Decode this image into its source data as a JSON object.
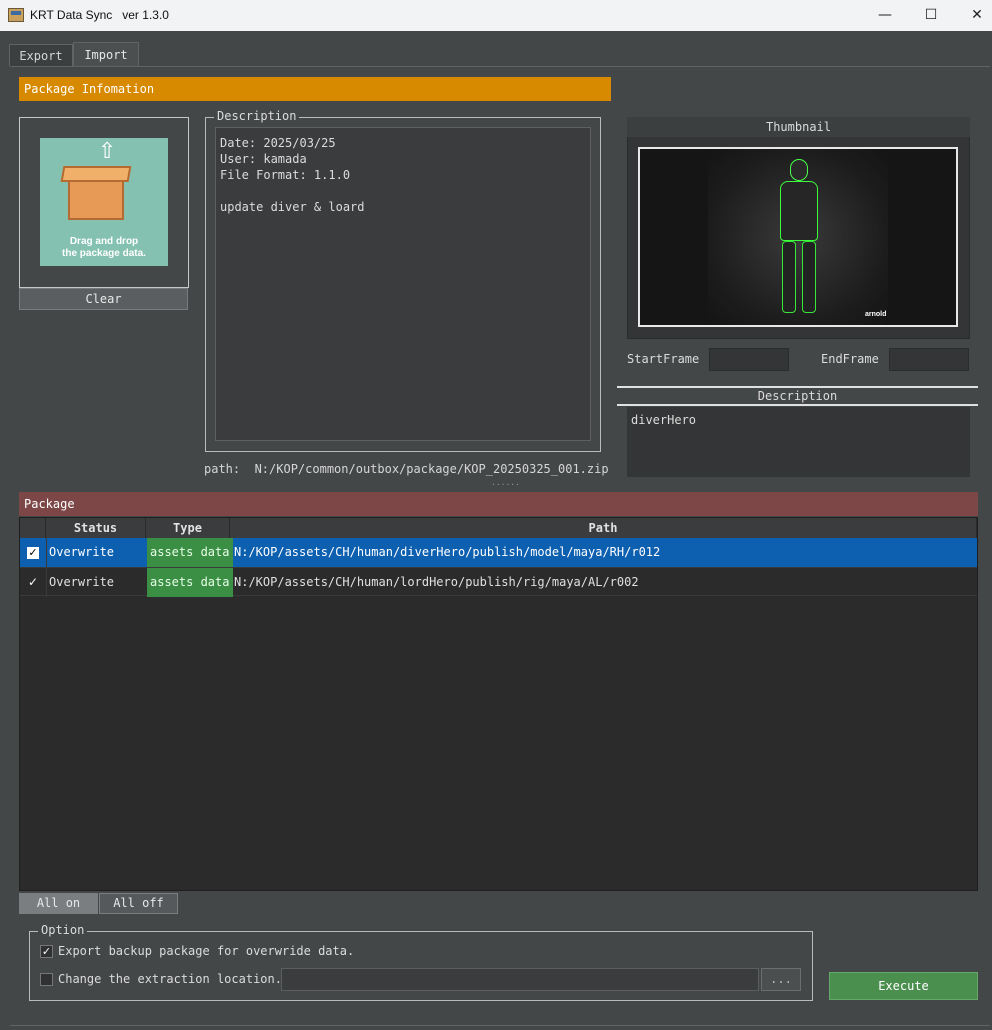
{
  "window": {
    "title": "KRT Data Sync   ver 1.3.0",
    "minimize": "—",
    "maximize": "☐",
    "close": "✕"
  },
  "tabs": [
    {
      "label": "Export"
    },
    {
      "label": "Import"
    }
  ],
  "package_info": {
    "header": "Package Infomation",
    "drop_text": "Drag and drop\nthe package data.",
    "clear_label": "Clear",
    "description_title": "Description",
    "description_text": "Date: 2025/03/25\nUser: kamada\nFile Format: 1.1.0\n\nupdate diver & loard",
    "path_text": "path:  N:/KOP/common/outbox/package/KOP_20250325_001.zip",
    "splitter_dots": "......"
  },
  "thumbnail": {
    "title": "Thumbnail",
    "watermark": "arnold",
    "start_frame_label": "StartFrame",
    "end_frame_label": "EndFrame",
    "start_frame_value": "",
    "end_frame_value": "",
    "description_title": "Description",
    "description_text": "diverHero"
  },
  "package": {
    "header": "Package",
    "columns": {
      "status": "Status",
      "type": "Type",
      "path": "Path"
    },
    "rows": [
      {
        "checked": true,
        "status": "Overwrite",
        "type": "assets data",
        "path": "N:/KOP/assets/CH/human/diverHero/publish/model/maya/RH/r012",
        "selected": true
      },
      {
        "checked": true,
        "status": "Overwrite",
        "type": "assets data",
        "path": "N:/KOP/assets/CH/human/lordHero/publish/rig/maya/AL/r002",
        "selected": false
      }
    ],
    "all_on": "All on",
    "all_off": "All off"
  },
  "option": {
    "title": "Option",
    "backup_label": "Export backup package for overwride data.",
    "backup_checked": true,
    "change_location_label": "Change the extraction location.",
    "change_location_checked": false,
    "location_value": "",
    "browse_label": "...",
    "execute_label": "Execute"
  },
  "colors": {
    "accent_orange": "#d78a00",
    "package_header": "#7d4748",
    "selected_row": "#0d5fb0",
    "type_cell": "#3a8f44",
    "execute": "#4b8f4f"
  },
  "icons": {
    "app": "krt-app-icon",
    "drop": "box-upload-icon",
    "check": "checkmark-icon"
  }
}
